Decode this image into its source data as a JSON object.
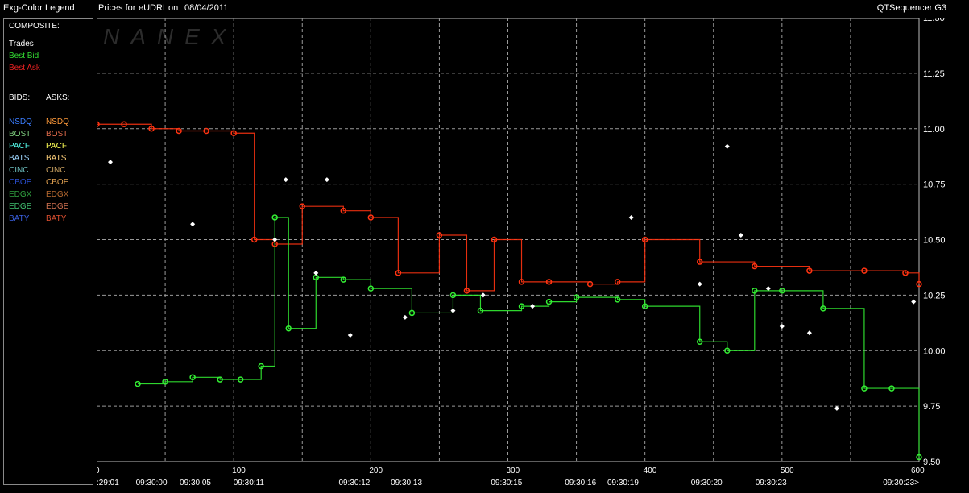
{
  "header": {
    "legend_title": "Exg-Color Legend",
    "prices_for": "Prices for",
    "symbol": "eUDRL",
    "on": "on",
    "date": "08/04/2011",
    "app": "QTSequencer G3"
  },
  "legend": {
    "composite_label": "COMPOSITE:",
    "composite": [
      {
        "label": "Trades",
        "color": "#ffffff"
      },
      {
        "label": "Best Bid",
        "color": "#33dd33"
      },
      {
        "label": "Best Ask",
        "color": "#ee2222"
      }
    ],
    "bids_label": "BIDS:",
    "asks_label": "ASKS:",
    "exchanges": [
      {
        "name": "NSDQ",
        "bid_color": "#3a7dff",
        "ask_color": "#ff9a3a"
      },
      {
        "name": "BOST",
        "bid_color": "#7fd07f",
        "ask_color": "#e06a4a"
      },
      {
        "name": "PACF",
        "bid_color": "#55ffee",
        "ask_color": "#ffff55"
      },
      {
        "name": "BATS",
        "bid_color": "#9fd7ff",
        "ask_color": "#ffd07a"
      },
      {
        "name": "CINC",
        "bid_color": "#6bbbbb",
        "ask_color": "#c8a060"
      },
      {
        "name": "CBOE",
        "bid_color": "#2a4fd0",
        "ask_color": "#e0a050"
      },
      {
        "name": "EDGX",
        "bid_color": "#30a040",
        "ask_color": "#b86a30"
      },
      {
        "name": "EDGE",
        "bid_color": "#40c070",
        "ask_color": "#d07050"
      },
      {
        "name": "BATY",
        "bid_color": "#3a60e0",
        "ask_color": "#e05030"
      }
    ]
  },
  "watermark": "NANEX",
  "chart_data": {
    "type": "line",
    "title": "Prices for eUDRL on 08/04/2011",
    "x_ticks": [
      0,
      100,
      200,
      300,
      400,
      500,
      600
    ],
    "x_range": [
      0,
      600
    ],
    "time_labels": [
      {
        "x": 0,
        "label": ":29:01"
      },
      {
        "x": 40,
        "label": "09:30:00"
      },
      {
        "x": 72,
        "label": "09:30:05"
      },
      {
        "x": 111,
        "label": "09:30:11"
      },
      {
        "x": 188,
        "label": "09:30:12"
      },
      {
        "x": 226,
        "label": "09:30:13"
      },
      {
        "x": 299,
        "label": "09:30:15"
      },
      {
        "x": 353,
        "label": "09:30:16"
      },
      {
        "x": 384,
        "label": "09:30:19"
      },
      {
        "x": 445,
        "label": "09:30:20"
      },
      {
        "x": 492,
        "label": "09:30:23"
      },
      {
        "x": 600,
        "label": "09:30:23>"
      }
    ],
    "y_ticks": [
      9.5,
      9.75,
      10.0,
      10.25,
      10.5,
      10.75,
      11.0,
      11.25,
      11.5
    ],
    "y_range": [
      9.5,
      11.5
    ],
    "grid": true,
    "series": [
      {
        "name": "Best Ask",
        "color": "#ff3311",
        "x": [
          0,
          20,
          40,
          60,
          80,
          100,
          115,
          130,
          150,
          180,
          200,
          220,
          250,
          270,
          290,
          310,
          330,
          360,
          380,
          400,
          440,
          480,
          520,
          560,
          590,
          600
        ],
        "y": [
          11.02,
          11.02,
          11.0,
          10.99,
          10.99,
          10.98,
          10.5,
          10.48,
          10.65,
          10.63,
          10.6,
          10.35,
          10.52,
          10.27,
          10.5,
          10.31,
          10.31,
          10.3,
          10.31,
          10.5,
          10.4,
          10.38,
          10.36,
          10.36,
          10.35,
          10.3
        ]
      },
      {
        "name": "Best Bid",
        "color": "#33ee33",
        "x": [
          30,
          50,
          70,
          90,
          105,
          120,
          130,
          140,
          160,
          180,
          200,
          230,
          260,
          280,
          310,
          330,
          350,
          380,
          400,
          440,
          460,
          480,
          500,
          530,
          560,
          580,
          600
        ],
        "y": [
          9.85,
          9.86,
          9.88,
          9.87,
          9.87,
          9.93,
          10.6,
          10.1,
          10.33,
          10.32,
          10.28,
          10.17,
          10.25,
          10.18,
          10.2,
          10.22,
          10.24,
          10.23,
          10.2,
          10.04,
          10.0,
          10.27,
          10.27,
          10.19,
          9.83,
          9.83,
          9.52
        ]
      },
      {
        "name": "Trades",
        "color": "#ffffff",
        "x": [
          10,
          70,
          130,
          138,
          160,
          168,
          185,
          225,
          260,
          282,
          318,
          390,
          440,
          460,
          470,
          490,
          500,
          520,
          540,
          596
        ],
        "y": [
          10.85,
          10.57,
          10.5,
          10.77,
          10.35,
          10.77,
          10.07,
          10.15,
          10.18,
          10.25,
          10.2,
          10.6,
          10.3,
          10.92,
          10.52,
          10.28,
          10.11,
          10.08,
          9.74,
          10.22
        ]
      }
    ]
  }
}
